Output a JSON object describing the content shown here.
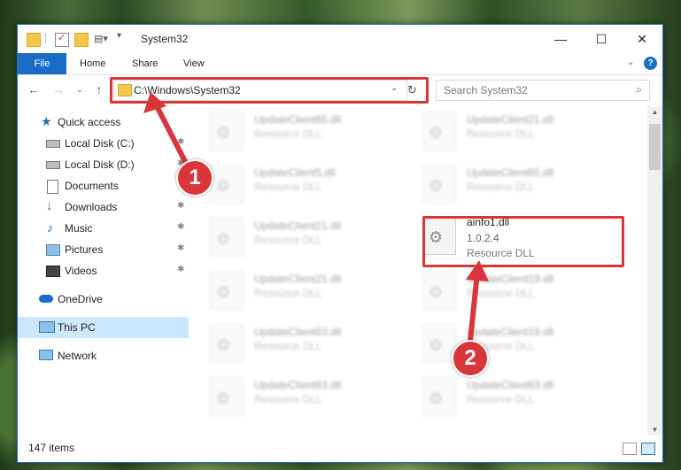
{
  "window": {
    "title": "System32",
    "controls": {
      "minimize": "—",
      "maximize": "☐",
      "close": "✕"
    }
  },
  "ribbon": {
    "tabs": [
      "File",
      "Home",
      "Share",
      "View"
    ]
  },
  "address": {
    "path": "C:\\Windows\\System32",
    "search_placeholder": "Search System32"
  },
  "sidebar": {
    "items": [
      {
        "label": "Quick access",
        "icon": "star-icon",
        "pinned": false
      },
      {
        "label": "Local Disk (C:)",
        "icon": "drive-icon",
        "pinned": true
      },
      {
        "label": "Local Disk (D:)",
        "icon": "drive-icon",
        "pinned": true
      },
      {
        "label": "Documents",
        "icon": "documents-icon",
        "pinned": true
      },
      {
        "label": "Downloads",
        "icon": "download-icon",
        "pinned": true
      },
      {
        "label": "Music",
        "icon": "music-icon",
        "pinned": true
      },
      {
        "label": "Pictures",
        "icon": "pictures-icon",
        "pinned": true
      },
      {
        "label": "Videos",
        "icon": "videos-icon",
        "pinned": true
      },
      {
        "label": "OneDrive",
        "icon": "cloud-icon",
        "pinned": false
      },
      {
        "label": "This PC",
        "icon": "computer-icon",
        "pinned": false
      },
      {
        "label": "Network",
        "icon": "network-icon",
        "pinned": false
      }
    ],
    "pin_glyph": "📌"
  },
  "files": {
    "left_column": [
      {
        "name": "UpdateClient65.dll",
        "type": "Resource DLL"
      },
      {
        "name": "UpdateClient21.dll",
        "type": "Resource DLL"
      },
      {
        "name": "UpdateClient21.dll",
        "type": "Resource DLL"
      },
      {
        "name": "UpdateClient63.dll",
        "type": "Resource DLL"
      },
      {
        "name": "UpdateClient63.dll",
        "type": "Resource DLL"
      },
      {
        "name": "UpdateClient5.dll",
        "type": "Resource DLL"
      }
    ],
    "right_column": [
      {
        "name": "UpdateClient21.dll",
        "type": "Resource DLL"
      },
      {
        "name": "UpdateClient65.dll",
        "type": "Resource DLL"
      },
      {
        "name": "ainfo1.dll",
        "version": "1.0.2.4",
        "type": "Resource DLL"
      },
      {
        "name": "UpdateClient19.dll",
        "type": "Resource DLL"
      },
      {
        "name": "UpdateClient19.dll",
        "type": "Resource DLL"
      },
      {
        "name": "UpdateClient63.dll",
        "type": "Resource DLL"
      }
    ]
  },
  "status": {
    "item_count": "147 items"
  },
  "callouts": {
    "one": "1",
    "two": "2"
  },
  "colors": {
    "accent": "#1a6dc7",
    "highlight": "#d9363b",
    "selected": "#cce8ff"
  }
}
